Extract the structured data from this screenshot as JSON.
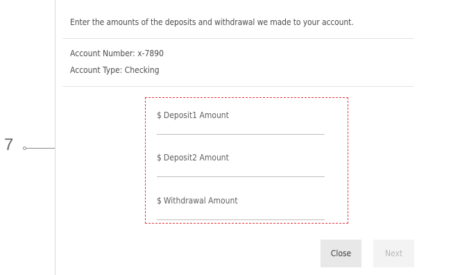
{
  "dialog": {
    "instructions": "Enter the amounts of the deposits and withdrawal we made to your account.",
    "account_number": "Account Number: x-7890",
    "account_type": "Account Type: Checking"
  },
  "fields": [
    {
      "currency": "$",
      "placeholder": "Deposit1 Amount"
    },
    {
      "currency": "$",
      "placeholder": "Deposit2 Amount"
    },
    {
      "currency": "$",
      "placeholder": "Withdrawal Amount"
    }
  ],
  "buttons": {
    "close": "Close",
    "next": "Next"
  },
  "callout": {
    "number": "7",
    "highlight_color": "#e0333a"
  }
}
